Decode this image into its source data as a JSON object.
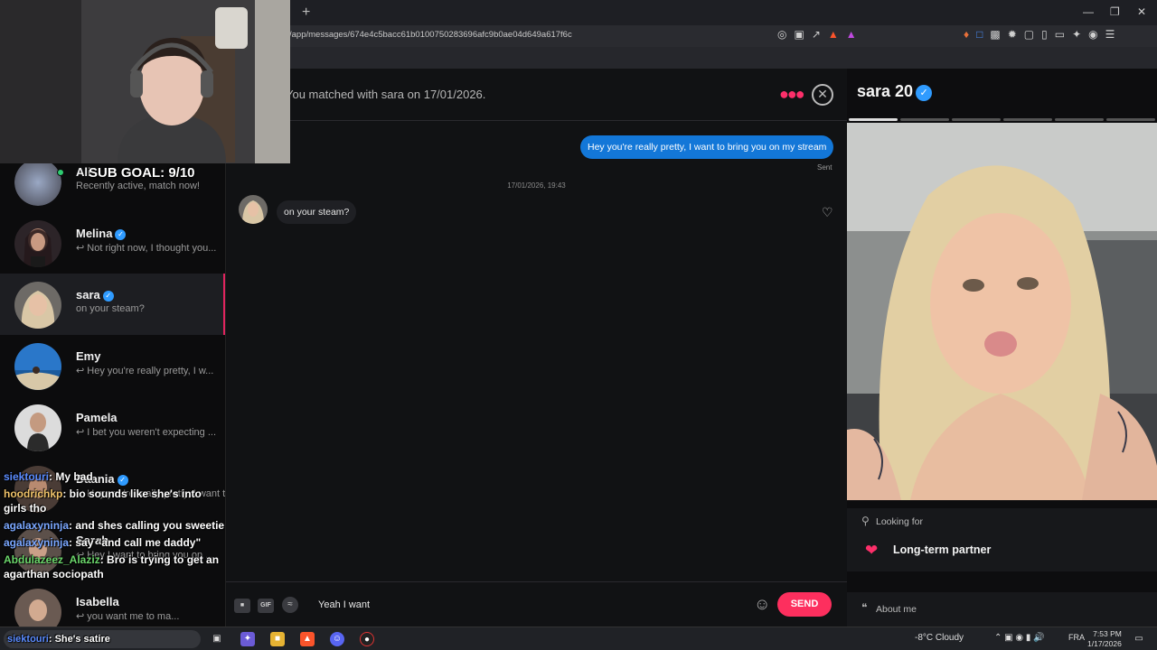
{
  "browser": {
    "new_tab_label": "+",
    "url": "/app/messages/674e4c5bacc61b0100750283696afc9b0ae04d649a617f6c",
    "window_controls": [
      "—",
      "❐",
      "✕"
    ]
  },
  "sidebar": {
    "conversations": [
      {
        "name": "Ali",
        "preview": "Recently active, match now!",
        "verified": false,
        "online": true
      },
      {
        "name": "Melina",
        "preview": "↩ Not right now, I thought you...",
        "verified": true
      },
      {
        "name": "sara",
        "preview": "on your steam?",
        "verified": true,
        "active": true
      },
      {
        "name": "Emy",
        "preview": "↩ Hey you're really pretty, I w...",
        "verified": false
      },
      {
        "name": "Pamela",
        "preview": "↩ I bet you weren't expecting ...",
        "verified": false
      },
      {
        "name": "Daania",
        "preview": "↩ Hey you're really pretty, I want to...",
        "verified": true
      },
      {
        "name": "Sarah",
        "preview": "↩ Hey I want to bring you on ...",
        "verified": false
      },
      {
        "name": "Isabella",
        "preview": "↩ you want me to ma...",
        "verified": false
      }
    ]
  },
  "chat": {
    "match_text": "You matched with sara on 17/01/2026.",
    "outgoing_message": "Hey you're really pretty, I want to bring you on my stream",
    "sent_label": "Sent",
    "timestamp": "17/01/2026, 19:43",
    "incoming_message": "on your steam?",
    "input_value": "Yeah I want ",
    "gif_label": "GIF",
    "send_label": "SEND"
  },
  "profile": {
    "name": "sara 20",
    "photo_count": 6,
    "current_photo": 1,
    "looking_for_label": "Looking for",
    "looking_for_value": "Long-term partner",
    "about_label": "About me"
  },
  "stream": {
    "sub_goal": "SUB GOAL: 9/10",
    "chat": [
      {
        "user": "siektouri",
        "text": ": My bad",
        "color": "#5b8cff"
      },
      {
        "user": "hoodrichkp",
        "text": ": bio sounds like she's into girls tho",
        "color": "#f0c36a"
      },
      {
        "user": "agalaxyninja",
        "text": ": and shes calling you sweetie",
        "color": "#7aa7ff"
      },
      {
        "user": "agalaxyninja",
        "text": ": say \"and call me daddy\"",
        "color": "#7aa7ff"
      },
      {
        "user": "Abdulazeez_Alaziz",
        "text": ": Bro is trying to get an agarthan sociopath",
        "color": "#6bd66b"
      },
      {
        "user": "siektouri",
        "text": ": She's satire",
        "color": "#5b8cff"
      }
    ]
  },
  "taskbar": {
    "weather": "-8°C  Cloudy",
    "language": "FRA",
    "time": "7:53 PM",
    "date": "1/17/2026"
  },
  "colors": {
    "accent": "#fd2f5e",
    "bubble_out": "#1377d8",
    "verified": "#2f9bff"
  }
}
